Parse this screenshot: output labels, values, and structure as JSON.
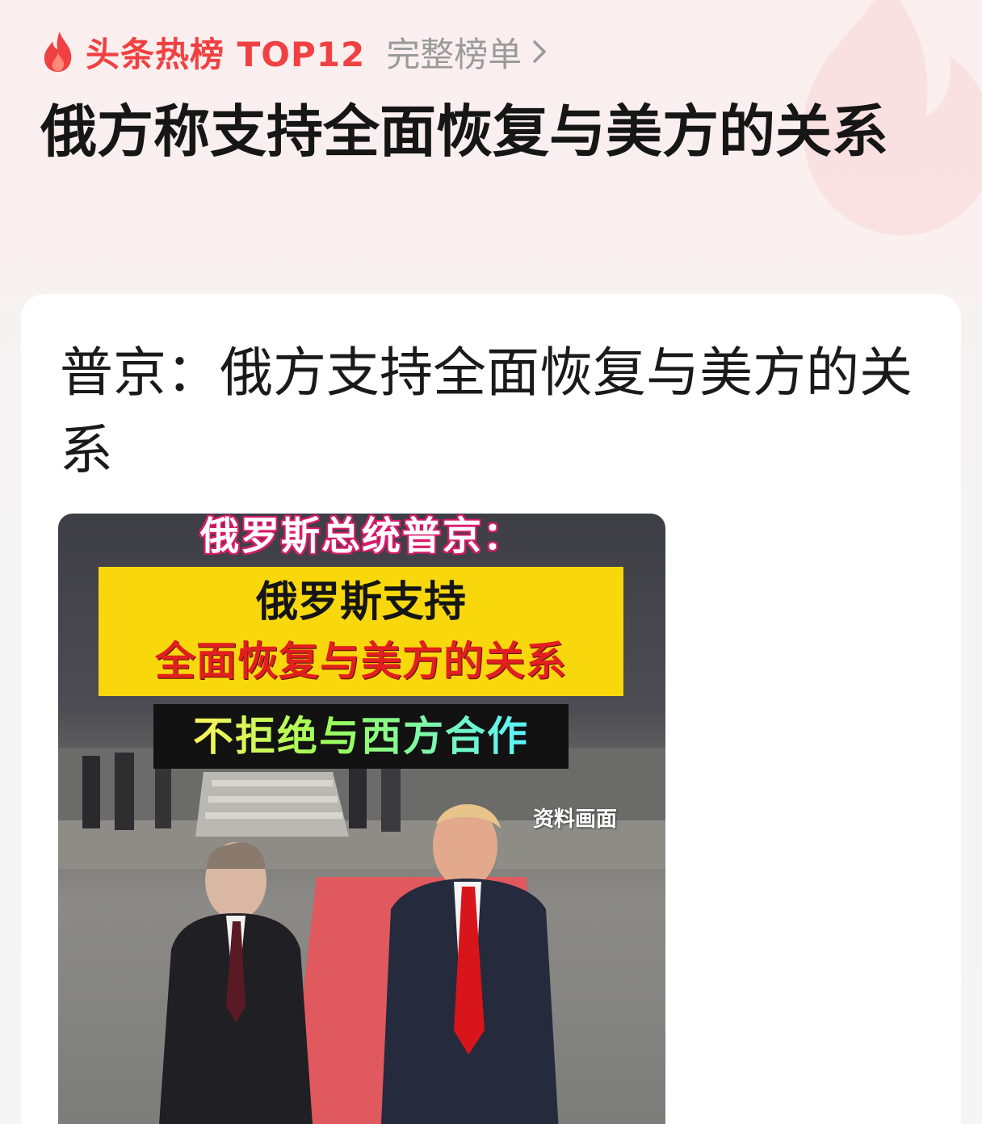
{
  "hot_header": {
    "title": "头条热榜 TOP12",
    "full_list_label": "完整榜单",
    "accent_color": "#f04142",
    "flame_icon": "flame-icon",
    "chevron_icon": "chevron-right-icon"
  },
  "main_title": "俄方称支持全面恢复与美方的关系",
  "card": {
    "title": "普京：俄方支持全面恢复与美方的关系",
    "video": {
      "caption_top": "俄罗斯总统普京：",
      "caption_yellow_line1": "俄罗斯支持",
      "caption_yellow_line2": "全面恢复与美方的关系",
      "caption_black": "不拒绝与西方合作",
      "archive_label": "资料画面"
    }
  }
}
